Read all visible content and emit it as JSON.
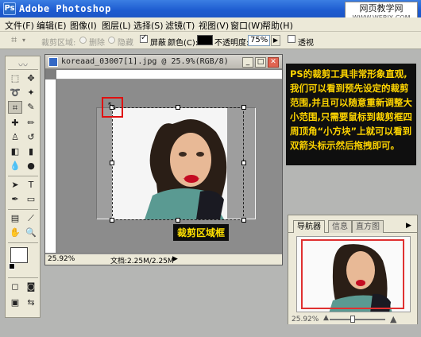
{
  "titlebar": {
    "app_title": "Adobe Photoshop",
    "logo_text": "Ps"
  },
  "watermark": {
    "line1": "网页教学网",
    "line2": "WWW.WEBJX.COM"
  },
  "menu": [
    "文件(F)",
    "编辑(E)",
    "图像(I)",
    "图层(L)",
    "选择(S)",
    "滤镜(T)",
    "视图(V)",
    "窗口(W)",
    "帮助(H)"
  ],
  "options": {
    "cropped_area_label": "裁剪区域:",
    "delete_label": "删除",
    "hide_label": "隐藏",
    "shield_label": "屏蔽",
    "shield_checked": true,
    "color_label": "颜色(C):",
    "color_value": "#000000",
    "opacity_label": "不透明度:",
    "opacity_value": "75%",
    "perspective_label": "透视",
    "perspective_checked": false
  },
  "document": {
    "title": "koreaad_03007[1].jpg @ 25.9%(RGB/8)",
    "zoom": "25.92%",
    "doc_size": "文档:2.25M/2.25M",
    "crop_label": "裁剪区域框"
  },
  "annotation": {
    "text": "PS的裁剪工具非常形象直观,我们可以看到预先设定的裁剪范围,并且可以随意重新调整大小范围,只需要鼠标到裁剪框四周顶角“小方块”上就可以看到双箭头标示然后拖拽即可。"
  },
  "navigator": {
    "tabs": [
      "导航器",
      "信息",
      "直方图"
    ],
    "active_tab": 0,
    "zoom": "25.92%"
  },
  "colors": {
    "accent_title": "#1d5bd0",
    "annotation_bg": "#0f0f0f",
    "annotation_text": "#ffd500",
    "highlight_red": "#e01010"
  }
}
